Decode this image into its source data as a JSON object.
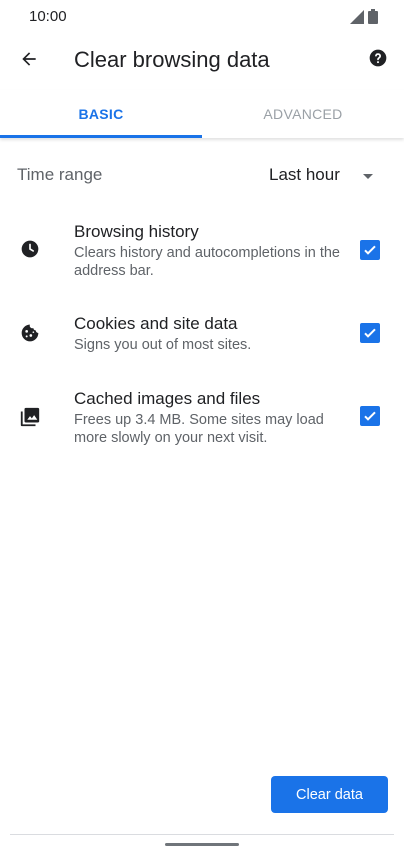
{
  "status_bar": {
    "time": "10:00"
  },
  "app_bar": {
    "title": "Clear browsing data"
  },
  "tabs": [
    {
      "label": "BASIC",
      "selected": true
    },
    {
      "label": "ADVANCED",
      "selected": false
    }
  ],
  "time_range": {
    "label": "Time range",
    "value": "Last hour"
  },
  "options": [
    {
      "title": "Browsing history",
      "description": "Clears history and autocompletions in the address bar.",
      "checked": true,
      "icon": "clock-icon"
    },
    {
      "title": "Cookies and site data",
      "description": "Signs you out of most sites.",
      "checked": true,
      "icon": "cookie-icon"
    },
    {
      "title": "Cached images and files",
      "description": "Frees up 3.4 MB. Some sites may load more slowly on your next visit.",
      "checked": true,
      "icon": "image-icon"
    }
  ],
  "actions": {
    "clear_label": "Clear data"
  },
  "colors": {
    "accent": "#1a73e8",
    "text_primary": "#202124",
    "text_secondary": "#5f6368",
    "tab_inactive": "#9aa0a6"
  }
}
